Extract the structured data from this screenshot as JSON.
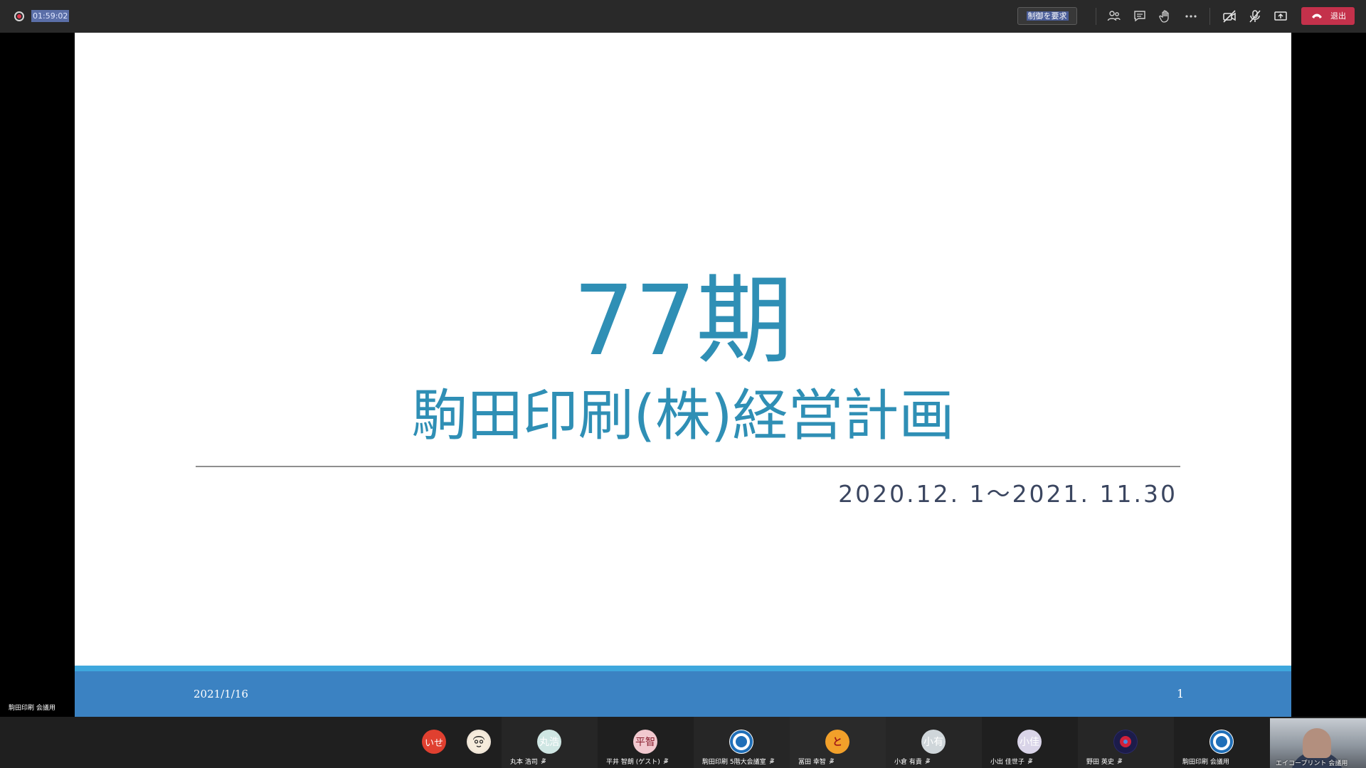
{
  "toolbar": {
    "timer": "01:59:02",
    "request_control": "制御を要求",
    "leave": "退出"
  },
  "slide": {
    "title_number": "77期",
    "subtitle": "駒田印刷(株)経営計画",
    "period": "2020.12. 1～2021. 11.30",
    "footer_date": "2021/1/16",
    "page_number": "1",
    "accent_color": "#2f8fb5",
    "footer_color": "#3b82c2"
  },
  "presenter_label": "駒田印刷 会議用",
  "participants": [
    {
      "initials": "いせ",
      "name": "",
      "bg": "#e04030",
      "fg": "#ffffff"
    },
    {
      "initials": "",
      "name": "",
      "bg": "#f0e6d8",
      "fg": "#222222"
    },
    {
      "initials": "丸浩",
      "name": "丸本 浩司",
      "bg": "#cfe6e3",
      "fg": "#ffffff"
    },
    {
      "initials": "平智",
      "name": "平井 智朗 (ゲスト)",
      "bg": "#f1c9cf",
      "fg": "#8a2030"
    },
    {
      "initials": "",
      "name": "駒田印刷 5階大会議室",
      "bg": "#1f6fb8",
      "fg": "#ffffff"
    },
    {
      "initials": "と",
      "name": "冨田 幸智",
      "bg": "#f2a02a",
      "fg": "#a01818"
    },
    {
      "initials": "小有",
      "name": "小倉 有貴",
      "bg": "#cfd6da",
      "fg": "#ffffff"
    },
    {
      "initials": "小佳",
      "name": "小出 佳世子",
      "bg": "#d9d4e8",
      "fg": "#ffffff"
    },
    {
      "initials": "",
      "name": "野田 英史",
      "bg": "#2a2a6a",
      "fg": "#ffffff"
    },
    {
      "initials": "",
      "name": "駒田印刷 会議用",
      "bg": "#1f6fb8",
      "fg": "#ffffff"
    }
  ],
  "video_participant": {
    "name": "エイコープリント 会議用"
  }
}
